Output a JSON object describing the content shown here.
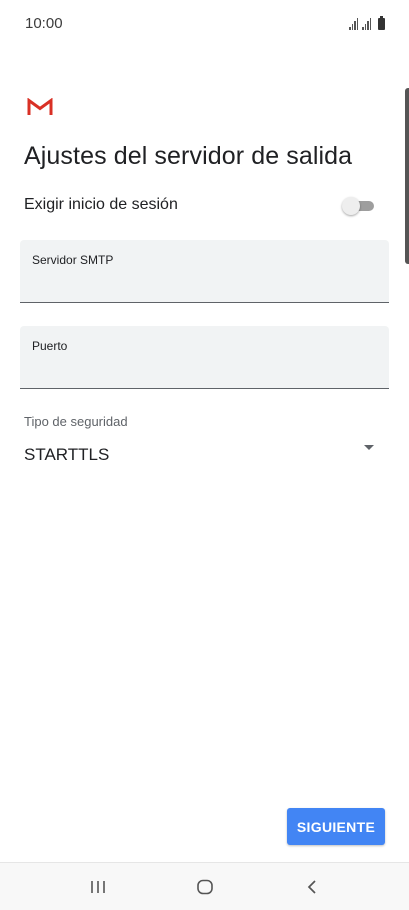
{
  "status_bar": {
    "time": "10:00",
    "icons": [
      "signal-icon",
      "signal-icon",
      "battery-icon"
    ]
  },
  "app": {
    "logo": "gmail-logo-icon",
    "accent_color": "#d93025"
  },
  "page": {
    "title": "Ajustes del servidor de salida",
    "require_login": {
      "label": "Exigir inicio de sesión",
      "enabled": false
    },
    "smtp_server": {
      "label": "Servidor SMTP",
      "value": ""
    },
    "port": {
      "label": "Puerto",
      "value": ""
    },
    "security_type": {
      "label": "Tipo de seguridad",
      "selected": "STARTTLS"
    },
    "next_button": {
      "label": "SIGUIENTE",
      "color": "#4285f4"
    }
  },
  "nav_bar": {
    "buttons": [
      "recents-icon",
      "home-icon",
      "back-icon"
    ]
  }
}
